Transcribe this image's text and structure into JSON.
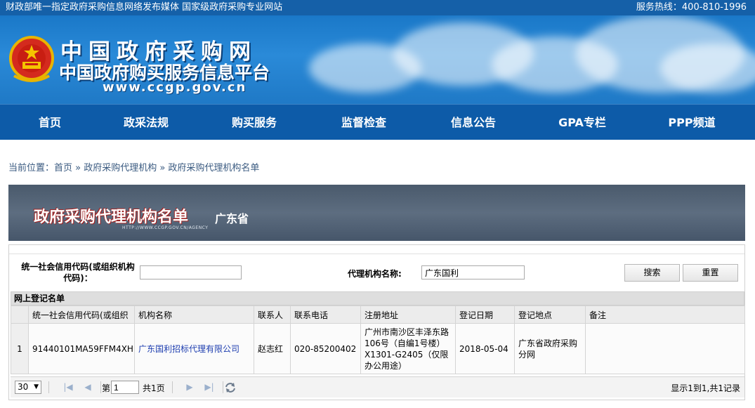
{
  "topbar": {
    "slogan": "财政部唯一指定政府采购信息网络发布媒体 国家级政府采购专业网站",
    "hotline": "服务热线：400-810-1996"
  },
  "header": {
    "site_name": "中国政府采购网",
    "site_subtitle": "中国政府购买服务信息平台",
    "site_url": "www.ccgp.gov.cn"
  },
  "nav": [
    "首页",
    "政采法规",
    "购买服务",
    "监督检查",
    "信息公告",
    "GPA专栏",
    "PPP频道"
  ],
  "breadcrumb": "当前位置：首页 » 政府采购代理机构 » 政府采购代理机构名单",
  "title_banner": {
    "title": "政府采购代理机构名单",
    "province": "广东省",
    "url": "HTTP://WWW.CCGP.GOV.CN/AGENCY"
  },
  "search": {
    "code_label": "统一社会信用代码(或组织机构代码)：",
    "code_value": "",
    "name_label": "代理机构名称:",
    "name_value": "广东国利",
    "search_button": "搜索",
    "reset_button": "重置"
  },
  "grid": {
    "title": "网上登记名单",
    "columns": [
      "",
      "统一社会信用代码(或组织",
      "机构名称",
      "联系人",
      "联系电话",
      "注册地址",
      "登记日期",
      "登记地点",
      "备注"
    ],
    "rows": [
      {
        "num": "1",
        "code": "91440101MA59FFM4XH",
        "name": "广东国利招标代理有限公司",
        "contact": "赵志红",
        "phone": "020-85200402",
        "address": "广州市南沙区丰泽东路106号（自编1号楼）X1301-G2405（仅限办公用途）",
        "date": "2018-05-04",
        "place": "广东省政府采购分网",
        "remark": ""
      }
    ]
  },
  "pager": {
    "page_size": "30",
    "page_prefix": "第",
    "page_value": "1",
    "page_suffix": "共1页",
    "info": "显示1到1,共1记录"
  }
}
